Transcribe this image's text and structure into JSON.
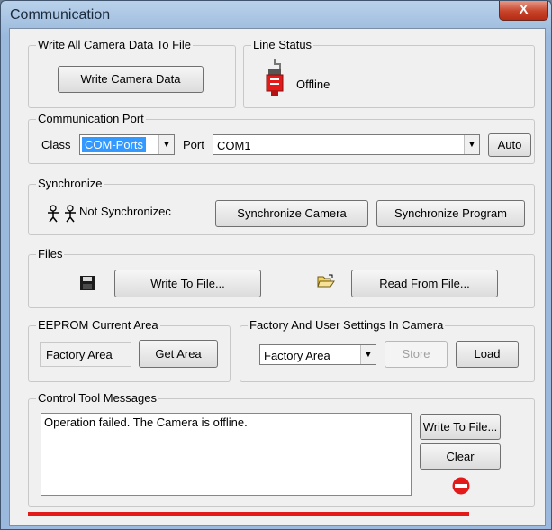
{
  "window": {
    "title": "Communication",
    "close_glyph": "X"
  },
  "write_all": {
    "group_label": "Write All Camera Data To File",
    "button_label": "Write Camera Data"
  },
  "line_status": {
    "group_label": "Line Status",
    "status_text": "Offline",
    "icon": "red-camera-connector-icon"
  },
  "comm_port": {
    "group_label": "Communication Port",
    "class_label": "Class",
    "class_value": "COM-Ports",
    "port_label": "Port",
    "port_value": "COM1",
    "auto_label": "Auto"
  },
  "synchronize": {
    "group_label": "Synchronize",
    "status_text": "Not Synchronizec",
    "sync_camera_label": "Synchronize Camera",
    "sync_program_label": "Synchronize Program"
  },
  "files": {
    "group_label": "Files",
    "write_label": "Write To File...",
    "read_label": "Read From File..."
  },
  "eeprom": {
    "group_label": "EEPROM Current Area",
    "area_value": "Factory Area",
    "get_area_label": "Get Area"
  },
  "factory_user": {
    "group_label": "Factory And User Settings In Camera",
    "select_value": "Factory Area",
    "store_label": "Store",
    "load_label": "Load"
  },
  "messages": {
    "group_label": "Control Tool Messages",
    "text": "Operation failed. The Camera is offline.",
    "write_label": "Write To File...",
    "clear_label": "Clear"
  },
  "colors": {
    "accent_select": "#3399ff",
    "error": "#e31a1a",
    "progress": "#e31a1a"
  }
}
